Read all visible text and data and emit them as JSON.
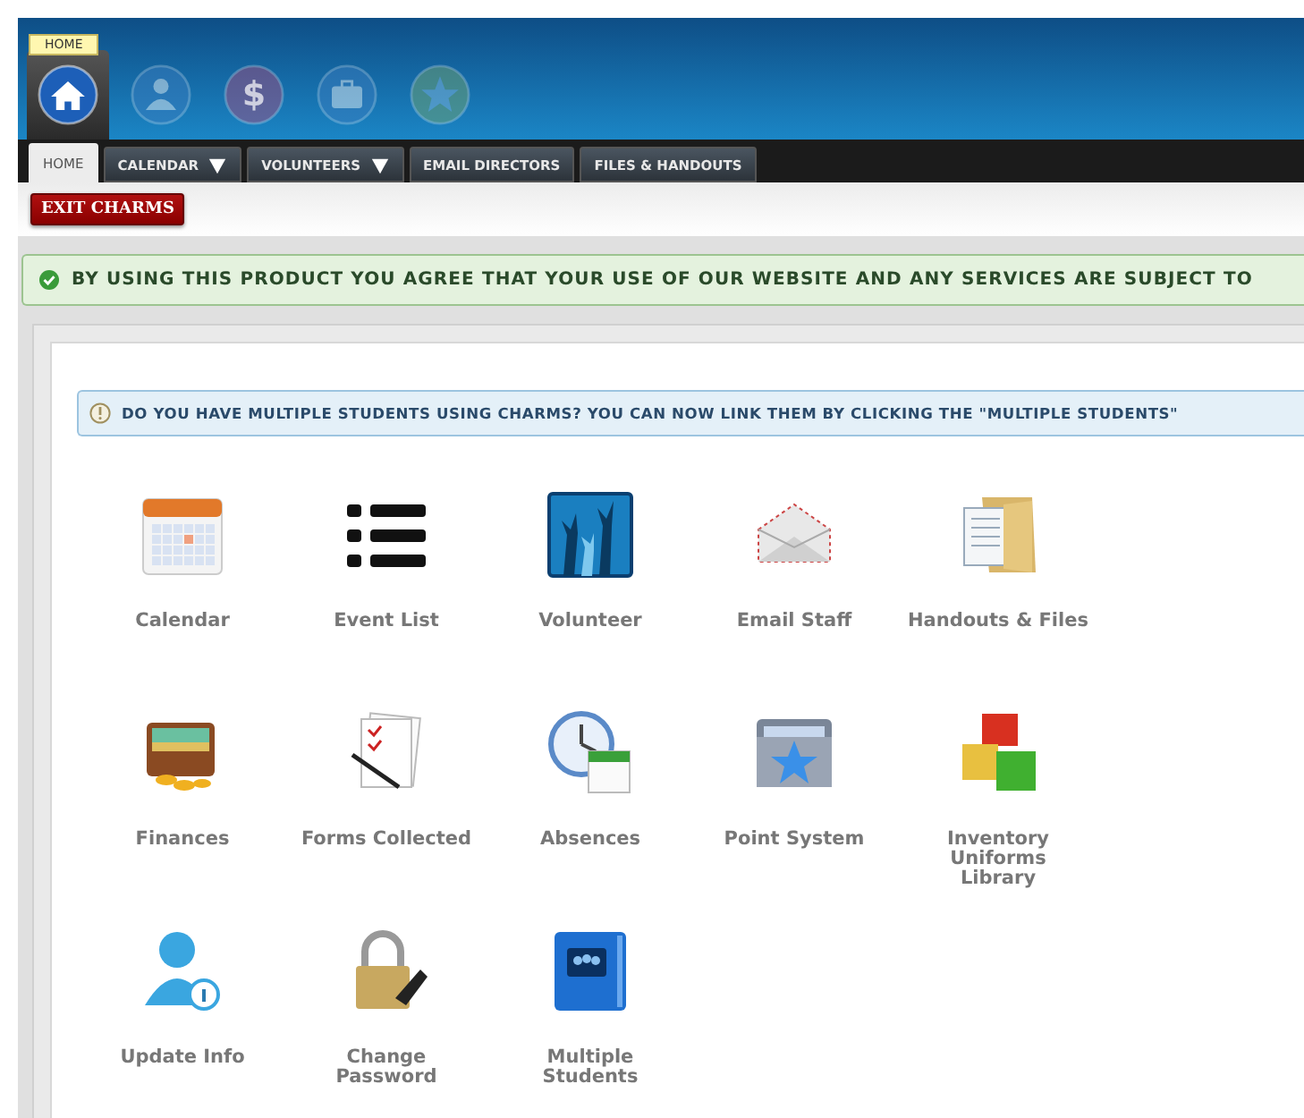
{
  "header": {
    "tooltip": "HOME",
    "icons": [
      {
        "kind": "home",
        "selected": true
      },
      {
        "kind": "person",
        "selected": false
      },
      {
        "kind": "dollar",
        "glyph": "$",
        "selected": false
      },
      {
        "kind": "briefcase",
        "selected": false
      },
      {
        "kind": "star",
        "selected": false
      }
    ]
  },
  "tabs": [
    {
      "label": "HOME",
      "selected": true,
      "has_menu": false
    },
    {
      "label": "CALENDAR",
      "selected": false,
      "has_menu": true
    },
    {
      "label": "VOLUNTEERS",
      "selected": false,
      "has_menu": true
    },
    {
      "label": "EMAIL DIRECTORS",
      "selected": false,
      "has_menu": false
    },
    {
      "label": "FILES & HANDOUTS",
      "selected": false,
      "has_menu": false
    }
  ],
  "exit_button": "EXIT CHARMS",
  "notice": "BY USING THIS PRODUCT YOU AGREE THAT YOUR USE OF OUR WEBSITE AND ANY SERVICES ARE SUBJECT TO",
  "info": "DO YOU HAVE MULTIPLE STUDENTS USING CHARMS? YOU CAN NOW LINK THEM BY CLICKING THE \"MULTIPLE STUDENTS\"",
  "tiles": [
    {
      "kind": "calendar",
      "label": "Calendar"
    },
    {
      "kind": "list",
      "label": "Event List"
    },
    {
      "kind": "hands",
      "label": "Volunteer"
    },
    {
      "kind": "envelope",
      "label": "Email Staff"
    },
    {
      "kind": "folder",
      "label": "Handouts & Files"
    },
    {
      "kind": "wallet",
      "label": "Finances"
    },
    {
      "kind": "forms",
      "label": "Forms Collected"
    },
    {
      "kind": "clock",
      "label": "Absences"
    },
    {
      "kind": "starfolder",
      "label": "Point System"
    },
    {
      "kind": "boxes",
      "label": "Inventory Uniforms Library"
    },
    {
      "kind": "user",
      "label": "Update Info"
    },
    {
      "kind": "lock",
      "label": "Change Password"
    },
    {
      "kind": "book",
      "label": "Multiple Students"
    }
  ]
}
